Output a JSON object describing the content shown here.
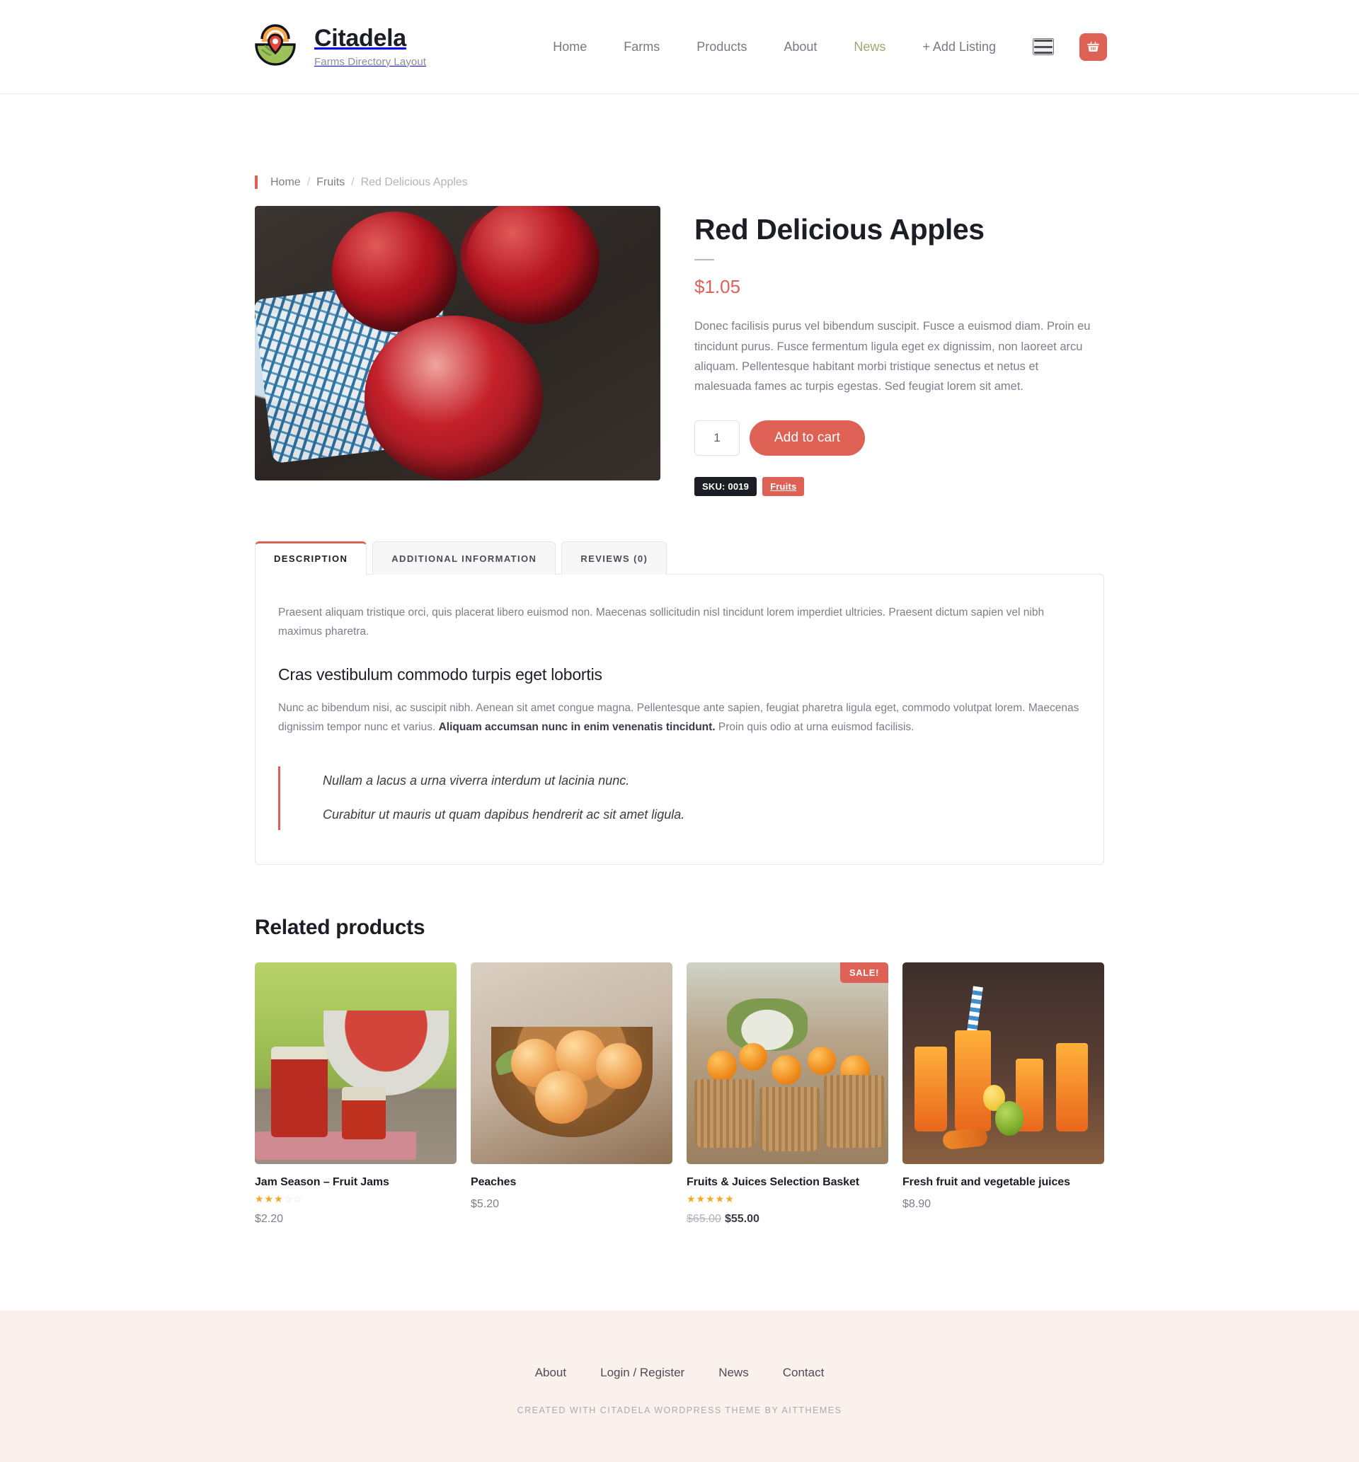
{
  "header": {
    "brand_title": "Citadela",
    "brand_subtitle": "Farms Directory Layout",
    "logo_icon": "farm-pin-logo-icon",
    "nav": [
      {
        "label": "Home",
        "current": false
      },
      {
        "label": "Farms",
        "current": false
      },
      {
        "label": "Products",
        "current": false
      },
      {
        "label": "About",
        "current": false
      },
      {
        "label": "News",
        "current": true
      },
      {
        "label": "+ Add Listing",
        "current": false
      }
    ],
    "hamburger_icon": "hamburger-menu-icon",
    "cart_icon": "shopping-basket-icon",
    "accent_color": "#dd6255",
    "current_nav_color": "#9aab6f"
  },
  "breadcrumb": {
    "home": "Home",
    "category": "Fruits",
    "current": "Red Delicious Apples",
    "separator": "/"
  },
  "product": {
    "image_alt": "red-delicious-apples-photo",
    "title": "Red Delicious Apples",
    "price": "$1.05",
    "description": "Donec facilisis purus vel bibendum suscipit. Fusce a euismod diam. Proin eu tincidunt purus. Fusce fermentum ligula eget ex dignissim, non laoreet arcu aliquam. Pellentesque habitant morbi tristique senectus et netus et malesuada fames ac turpis egestas. Sed feugiat lorem sit amet.",
    "quantity_value": "1",
    "quantity_placeholder": "1",
    "add_to_cart_label": "Add to cart",
    "sku_badge": "SKU: 0019",
    "category_badge": "Fruits"
  },
  "tabs": {
    "items": [
      {
        "label": "DESCRIPTION",
        "active": true
      },
      {
        "label": "ADDITIONAL INFORMATION",
        "active": false
      },
      {
        "label": "REVIEWS (0)",
        "active": false
      }
    ],
    "panel": {
      "intro": "Praesent aliquam tristique orci, quis placerat libero euismod non. Maecenas sollicitudin nisl tincidunt lorem imperdiet ultricies. Praesent dictum sapien vel nibh maximus pharetra.",
      "heading": "Cras vestibulum commodo turpis eget lobortis",
      "body_part1": "Nunc ac bibendum nisi, ac suscipit nibh. Aenean sit amet congue magna. Pellentesque ante sapien, feugiat pharetra ligula eget, commodo volutpat lorem. Maecenas dignissim tempor nunc et varius. ",
      "body_bold": "Aliquam accumsan nunc in enim venenatis tincidunt.",
      "body_part2": " Proin quis odio at urna euismod facilisis.",
      "quote_line1": "Nullam a lacus a urna viverra interdum ut lacinia nunc.",
      "quote_line2": "Curabitur ut mauris ut quam dapibus hendrerit ac sit amet ligula."
    }
  },
  "related": {
    "title": "Related products",
    "products": [
      {
        "name": "Jam Season – Fruit Jams",
        "image_alt": "strawberry-jam-jars-photo",
        "rating": 3,
        "has_rating": true,
        "price": "$2.20",
        "old_price": "",
        "on_sale": false,
        "sale_label": ""
      },
      {
        "name": "Peaches",
        "image_alt": "bowl-of-peaches-photo",
        "rating": 0,
        "has_rating": false,
        "price": "$5.20",
        "old_price": "",
        "on_sale": false,
        "sale_label": ""
      },
      {
        "name": "Fruits & Juices Selection Basket",
        "image_alt": "fruit-baskets-market-photo",
        "rating": 5,
        "has_rating": true,
        "price": "$55.00",
        "old_price": "$65.00",
        "on_sale": true,
        "sale_label": "SALE!"
      },
      {
        "name": "Fresh fruit and vegetable juices",
        "image_alt": "fresh-juice-bottles-photo",
        "rating": 0,
        "has_rating": false,
        "price": "$8.90",
        "old_price": "",
        "on_sale": false,
        "sale_label": ""
      }
    ]
  },
  "footer": {
    "nav": [
      {
        "label": "About"
      },
      {
        "label": "Login / Register"
      },
      {
        "label": "News"
      },
      {
        "label": "Contact"
      }
    ],
    "note": "CREATED WITH CITADELA WORDPRESS THEME BY AITTHEMES",
    "background": "#fbf1ec"
  }
}
